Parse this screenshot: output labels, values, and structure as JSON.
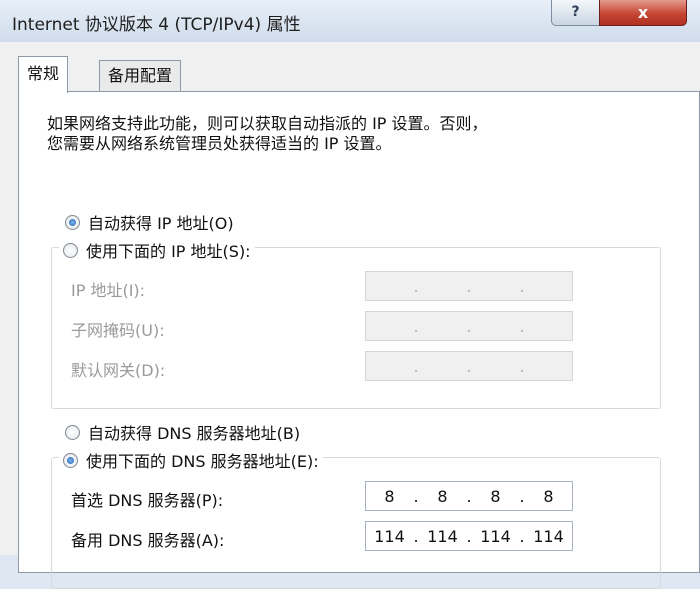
{
  "window": {
    "title": "Internet 协议版本 4 (TCP/IPv4) 属性",
    "help_label": "?",
    "close_label": "x"
  },
  "tabs": [
    {
      "label": "常规",
      "active": true
    },
    {
      "label": "备用配置",
      "active": false
    }
  ],
  "description": "如果网络支持此功能，则可以获取自动指派的 IP 设置。否则，\n您需要从网络系统管理员处获得适当的 IP 设置。",
  "ip_section": {
    "auto_label": "自动获得 IP 地址(O)",
    "manual_label": "使用下面的 IP 地址(S):",
    "auto_selected": true,
    "fields": [
      {
        "label": "IP 地址(I):",
        "octets": [
          "",
          "",
          "",
          ""
        ]
      },
      {
        "label": "子网掩码(U):",
        "octets": [
          "",
          "",
          "",
          ""
        ]
      },
      {
        "label": "默认网关(D):",
        "octets": [
          "",
          "",
          "",
          ""
        ]
      }
    ],
    "dot": "."
  },
  "dns_section": {
    "auto_label": "自动获得 DNS 服务器地址(B)",
    "manual_label": "使用下面的 DNS 服务器地址(E):",
    "manual_selected": true,
    "fields": [
      {
        "label": "首选 DNS 服务器(P):",
        "octets": [
          "8",
          "8",
          "8",
          "8"
        ]
      },
      {
        "label": "备用 DNS 服务器(A):",
        "octets": [
          "114",
          "114",
          "114",
          "114"
        ]
      }
    ],
    "dot": "."
  }
}
